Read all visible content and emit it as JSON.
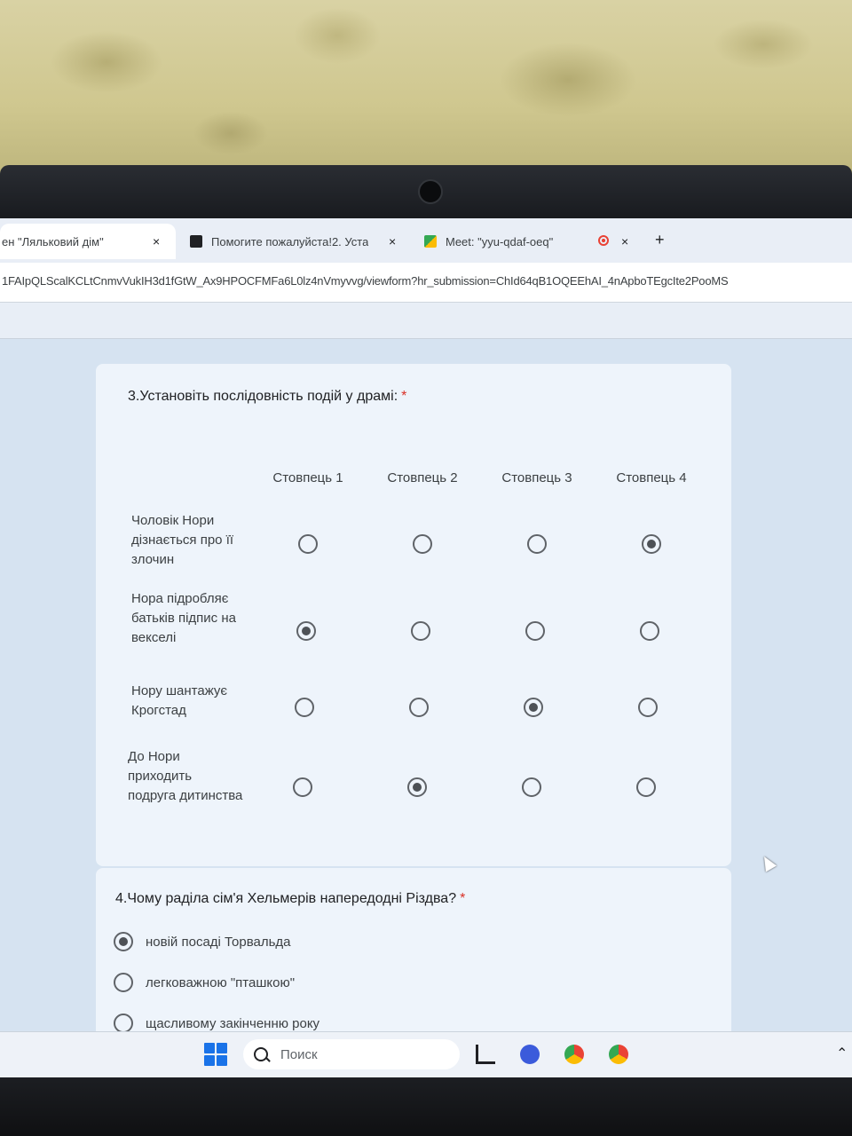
{
  "tabs": [
    {
      "title": "ен \"Ляльковий дім\"",
      "close": "×"
    },
    {
      "title": "Помогите пожалуйста!2. Уста",
      "close": "×"
    },
    {
      "title": "Meet: \"yyu-qdaf-oeq\"",
      "close": "×"
    }
  ],
  "new_tab": "+",
  "address": {
    "url": "1FAIpQLScalKCLtCnmvVukIH3d1fGtW_Ax9HPOCFMFa6L0lz4nVmyvvg/viewform?hr_submission=ChId64qB1OQEEhAI_4nApboTEgcIte2PooMS"
  },
  "question3": {
    "title": "3.Установіть послідовність подій у драмі:",
    "required": "*",
    "columns": [
      "Стовпець 1",
      "Стовпець 2",
      "Стовпець 3",
      "Стовпець 4"
    ],
    "rows": [
      {
        "label": "Чоловік Нори дізнається про її злочин",
        "selected": 4
      },
      {
        "label": "Нора підробляє батьків підпис на векселі",
        "selected": 1
      },
      {
        "label": "Нору шантажує Крогстад",
        "selected": 3
      },
      {
        "label": "До Нори приходить подруга дитинства",
        "selected": 2
      }
    ]
  },
  "question4": {
    "title": "4.Чому раділа сім'я Хельмерів напередодні Різдва?",
    "required": "*",
    "options": [
      {
        "label": "новій посаді Торвальда",
        "selected": true
      },
      {
        "label": "легковажною \"пташкою\"",
        "selected": false
      },
      {
        "label": "щасливому закінченню року",
        "selected": false
      }
    ]
  },
  "taskbar": {
    "search_placeholder": "Поиск",
    "icons": [
      "windows-start-icon",
      "search-icon",
      "task-view-icon",
      "chat-icon",
      "chrome-icon",
      "chrome-profile-icon",
      "chevron-up-icon"
    ]
  },
  "colors": {
    "accent": "#1a73e8",
    "required": "#d93025",
    "page_bg": "#d6e3f1",
    "card_bg": "#eef4fb"
  }
}
